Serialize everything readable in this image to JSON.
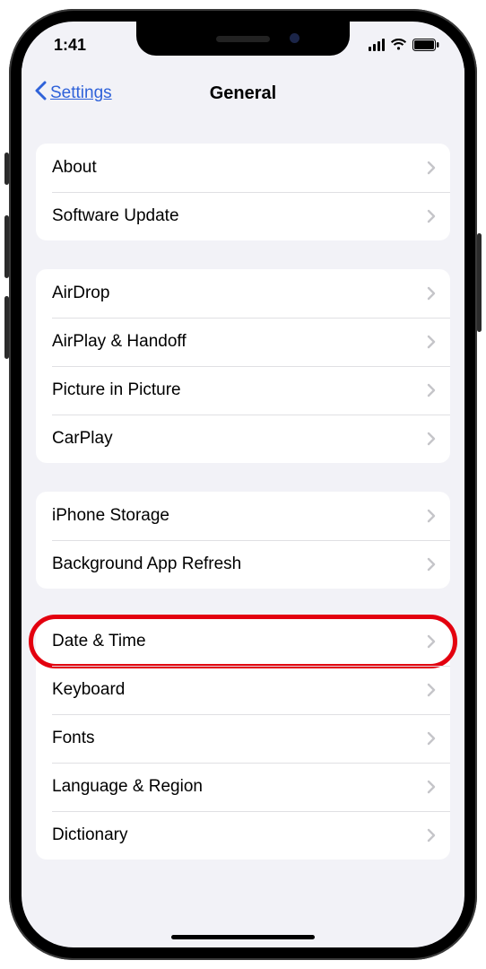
{
  "status": {
    "time": "1:41"
  },
  "nav": {
    "back": "Settings",
    "title": "General"
  },
  "groups": [
    {
      "items": [
        {
          "label": "About",
          "key": "about"
        },
        {
          "label": "Software Update",
          "key": "software-update"
        }
      ]
    },
    {
      "items": [
        {
          "label": "AirDrop",
          "key": "airdrop"
        },
        {
          "label": "AirPlay & Handoff",
          "key": "airplay-handoff"
        },
        {
          "label": "Picture in Picture",
          "key": "picture-in-picture"
        },
        {
          "label": "CarPlay",
          "key": "carplay"
        }
      ]
    },
    {
      "items": [
        {
          "label": "iPhone Storage",
          "key": "iphone-storage"
        },
        {
          "label": "Background App Refresh",
          "key": "background-app-refresh"
        }
      ]
    },
    {
      "items": [
        {
          "label": "Date & Time",
          "key": "date-time",
          "highlight": true
        },
        {
          "label": "Keyboard",
          "key": "keyboard"
        },
        {
          "label": "Fonts",
          "key": "fonts"
        },
        {
          "label": "Language & Region",
          "key": "language-region"
        },
        {
          "label": "Dictionary",
          "key": "dictionary"
        }
      ]
    }
  ]
}
